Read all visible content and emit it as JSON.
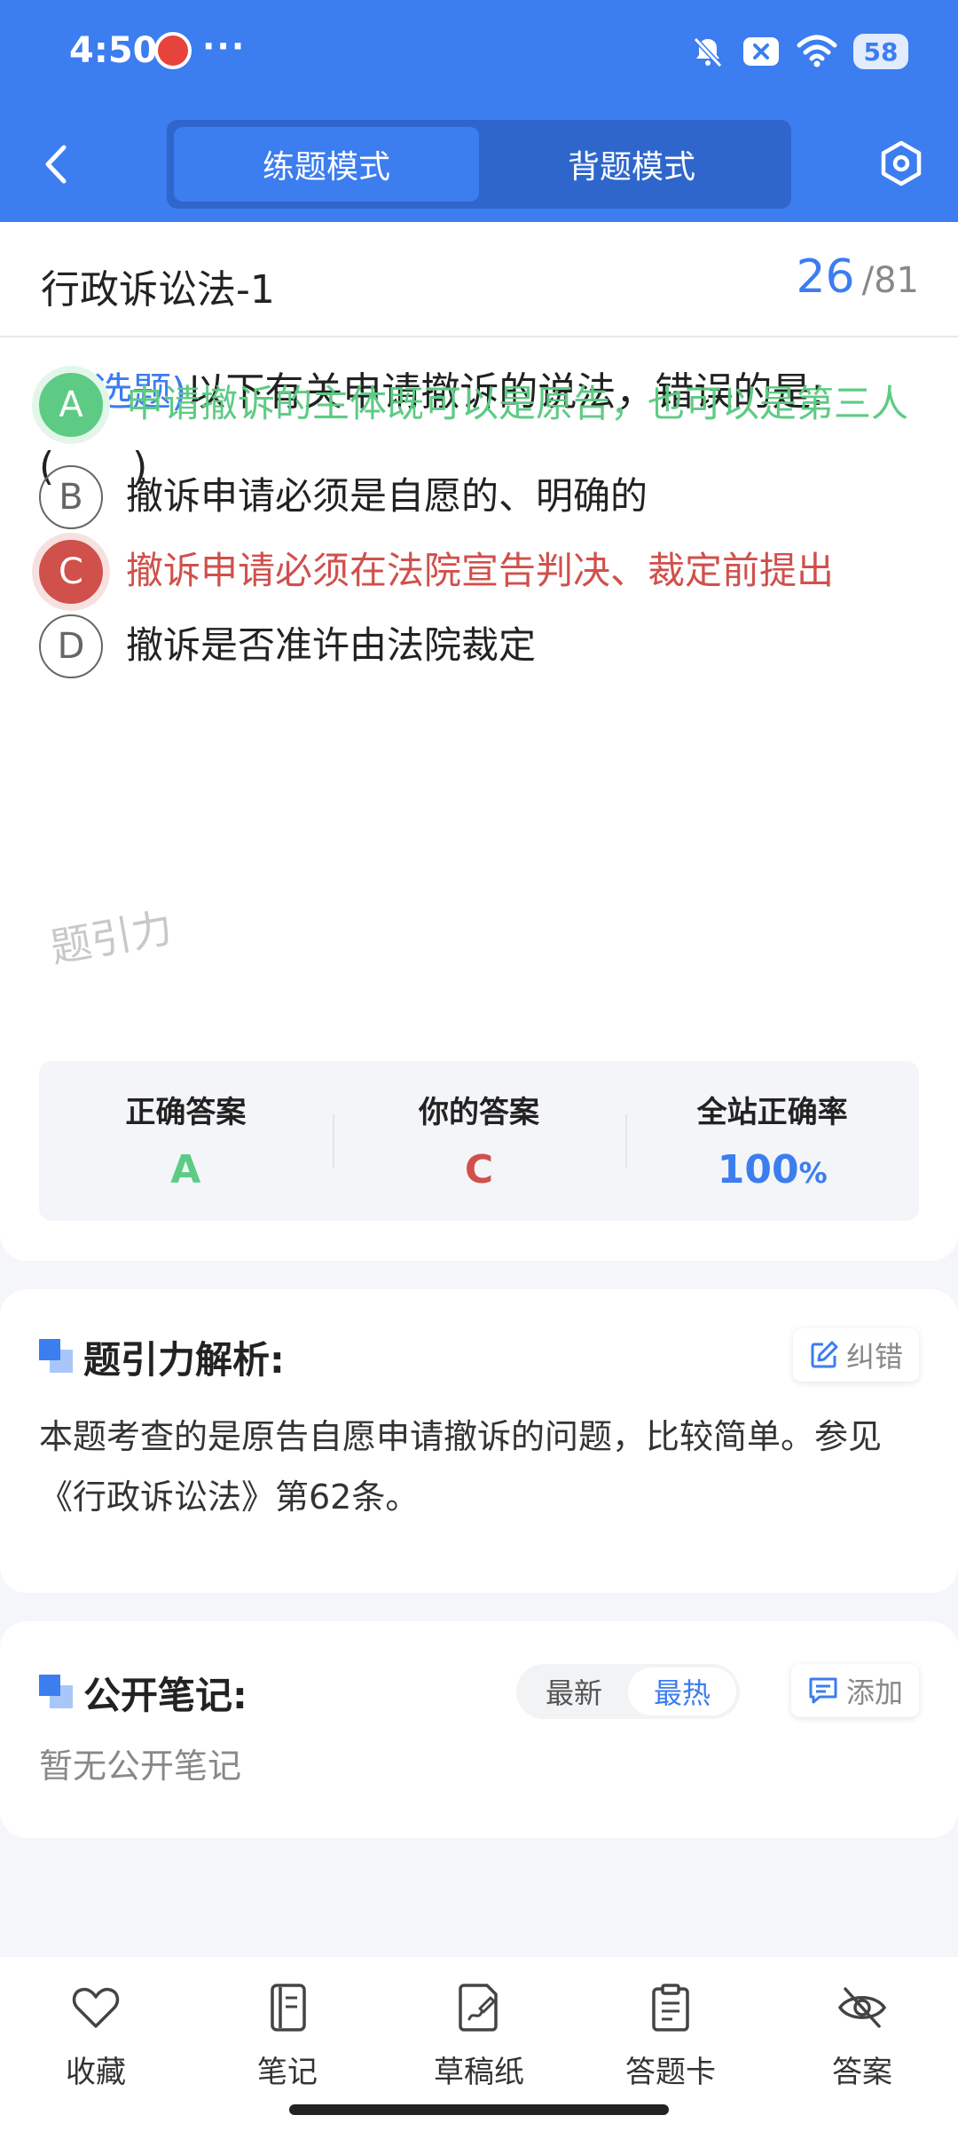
{
  "status_bar": {
    "time": "4:50",
    "dots": "···",
    "battery": "58"
  },
  "header": {
    "mode_tabs": [
      {
        "label": "练题模式",
        "active": true
      },
      {
        "label": "背题模式",
        "active": false
      }
    ]
  },
  "question": {
    "chapter": "行政诉讼法-1",
    "current": "26",
    "separator": "/",
    "total": "81",
    "type": "(单选题)",
    "text": "以下有关申请撤诉的说法，错误的是:(　　)",
    "options": [
      {
        "letter": "A",
        "text": "申请撤诉的主体既可以是原告，也可以是第三人",
        "state": "correct"
      },
      {
        "letter": "B",
        "text": "撤诉申请必须是自愿的、明确的",
        "state": "normal"
      },
      {
        "letter": "C",
        "text": "撤诉申请必须在法院宣告判决、裁定前提出",
        "state": "wrong"
      },
      {
        "letter": "D",
        "text": "撤诉是否准许由法院裁定",
        "state": "normal"
      }
    ]
  },
  "answer_summary": {
    "correct_label": "正确答案",
    "correct_value": "A",
    "yours_label": "你的答案",
    "yours_value": "C",
    "rate_label": "全站正确率",
    "rate_value": "100",
    "rate_unit": "%",
    "watermark": "题引力"
  },
  "analysis": {
    "title": "题引力解析:",
    "report_label": "纠错",
    "text": "本题考查的是原告自愿申请撤诉的问题，比较简单。参见《行政诉讼法》第62条。"
  },
  "notes": {
    "title": "公开笔记:",
    "sort_options": [
      {
        "label": "最新",
        "active": false
      },
      {
        "label": "最热",
        "active": true
      }
    ],
    "add_label": "添加",
    "empty_text": "暂无公开笔记"
  },
  "bottom_bar": [
    {
      "label": "收藏",
      "icon": "heart-icon"
    },
    {
      "label": "笔记",
      "icon": "notebook-icon"
    },
    {
      "label": "草稿纸",
      "icon": "draft-icon"
    },
    {
      "label": "答题卡",
      "icon": "answer-sheet-icon"
    },
    {
      "label": "答案",
      "icon": "eye-off-icon"
    }
  ],
  "colors": {
    "primary": "#3c7df0",
    "correct": "#5dcb84",
    "wrong": "#d0504c"
  }
}
